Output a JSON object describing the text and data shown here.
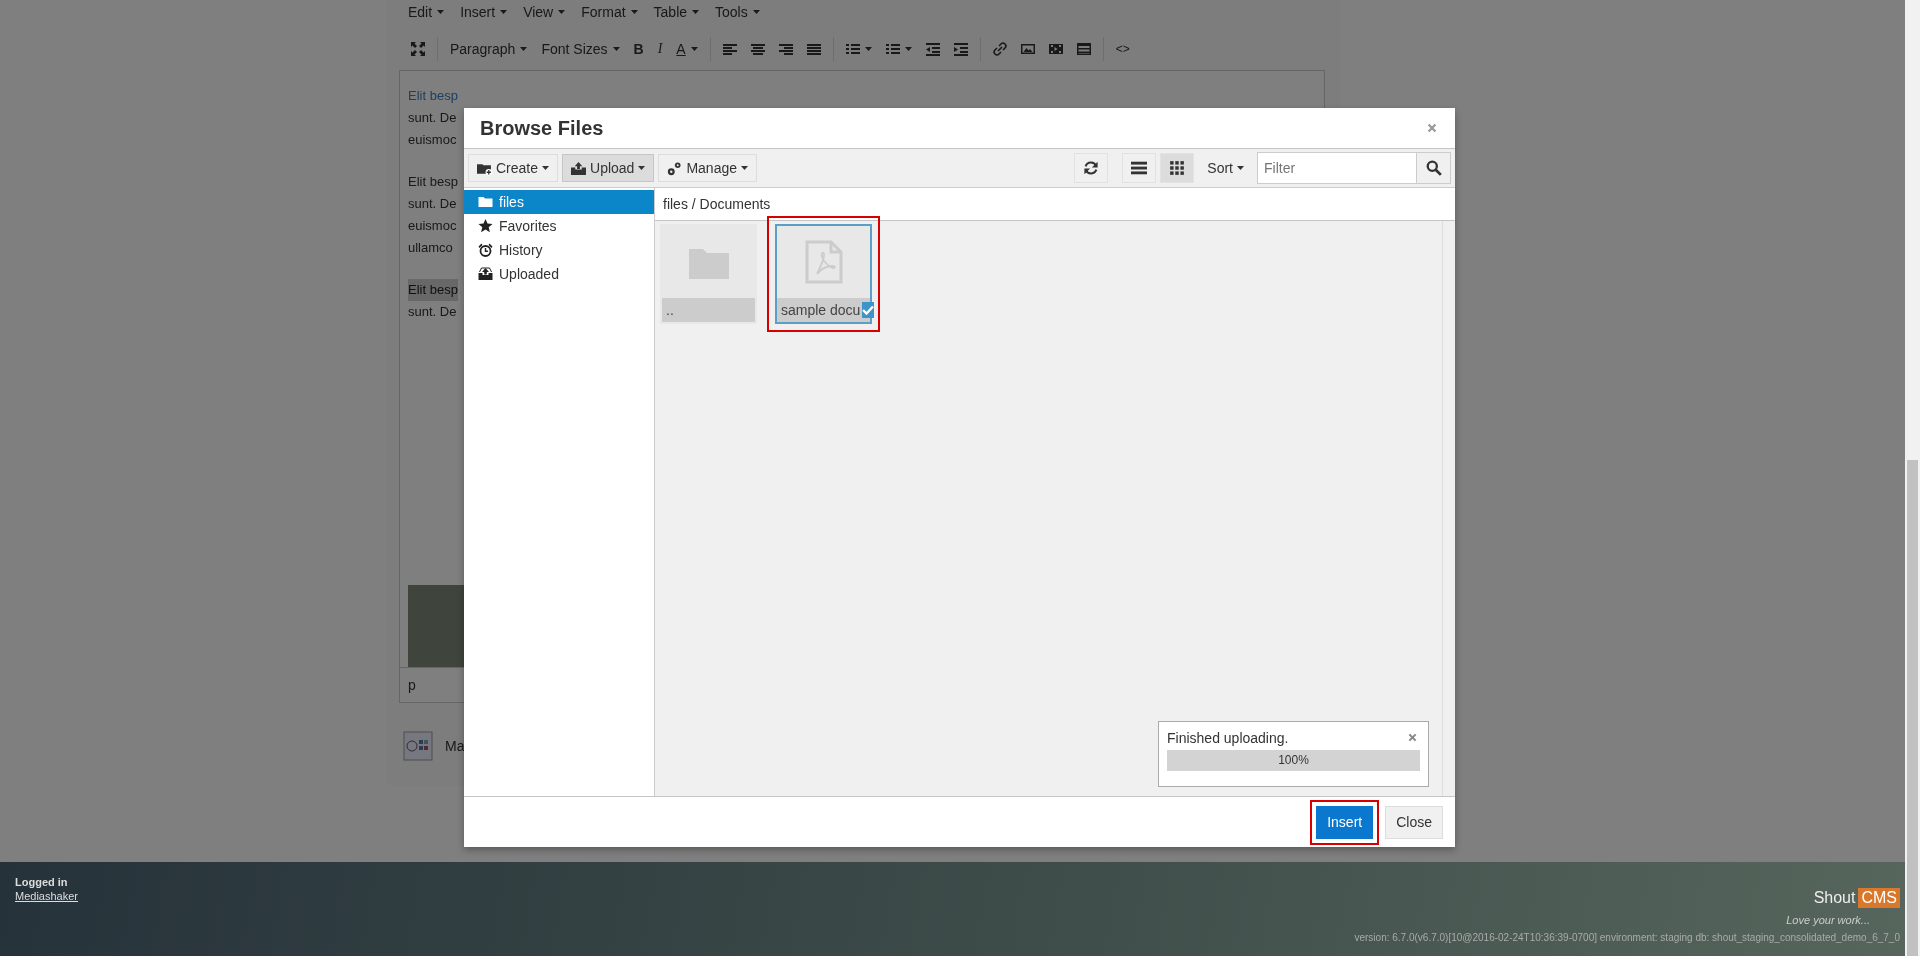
{
  "editor": {
    "menubar": [
      {
        "label": "Edit"
      },
      {
        "label": "Insert"
      },
      {
        "label": "View"
      },
      {
        "label": "Format"
      },
      {
        "label": "Table"
      },
      {
        "label": "Tools"
      }
    ],
    "toolbar": {
      "block_format": "Paragraph",
      "font_sizes": "Font Sizes",
      "bold": "B",
      "italic": "I",
      "text_color": "A",
      "source_code": "<>"
    },
    "paragraphs": [
      {
        "lines": [
          {
            "text": "Elit besp",
            "kind": "link"
          },
          {
            "text": "sunt. De",
            "kind": "plain"
          },
          {
            "text": "euismoc",
            "kind": "plain"
          }
        ]
      },
      {
        "lines": [
          {
            "text": "Elit besp",
            "kind": "plain"
          },
          {
            "text": "sunt. De",
            "kind": "plain"
          },
          {
            "text": "euismoc",
            "kind": "plain"
          },
          {
            "text": "ullamco",
            "kind": "plain"
          }
        ]
      },
      {
        "lines": [
          {
            "text": "Elit besp",
            "kind": "highlighted"
          },
          {
            "text": "sunt. De",
            "kind": "plain"
          }
        ]
      }
    ],
    "status_path": "p",
    "below_label": "Ma"
  },
  "dialog": {
    "title": "Browse Files",
    "toolbar": {
      "actions": [
        {
          "label": "Create",
          "pressed": false
        },
        {
          "label": "Upload",
          "pressed": true
        },
        {
          "label": "Manage",
          "pressed": false
        }
      ],
      "views": [
        {
          "kind": "list",
          "selected": false
        },
        {
          "kind": "grid",
          "selected": true
        }
      ],
      "sort": "Sort",
      "filter": {
        "placeholder": "Filter"
      }
    },
    "sidebar": [
      {
        "label": "files",
        "selected": true
      },
      {
        "label": "Favorites",
        "selected": false
      },
      {
        "label": "History",
        "selected": false
      },
      {
        "label": "Uploaded",
        "selected": false
      }
    ],
    "breadcrumb": "files / Documents",
    "tiles": [
      {
        "kind": "folder",
        "label": "..",
        "selected": false,
        "checked": false,
        "highlighted": false
      },
      {
        "kind": "pdf",
        "label": "sample docu",
        "selected": true,
        "checked": true,
        "highlighted": true
      }
    ],
    "notification": {
      "message": "Finished uploading.",
      "level": 1,
      "reading": "100%"
    },
    "buttons": [
      {
        "label": "Insert",
        "kind": "primary",
        "highlighted": true
      },
      {
        "label": "Close",
        "kind": "default",
        "highlighted": false
      }
    ]
  },
  "footer": {
    "logged_in": "Logged in",
    "user": "Mediashaker",
    "logo": {
      "word": "Shout",
      "badge": "CMS"
    },
    "tagline": "Love your work...",
    "version": "version: 6.7.0(v6.7.0)[10@2016-02-24T10:36:39-0700] environment: staging db: shout_staging_consolidated_demo_6_7_0"
  }
}
